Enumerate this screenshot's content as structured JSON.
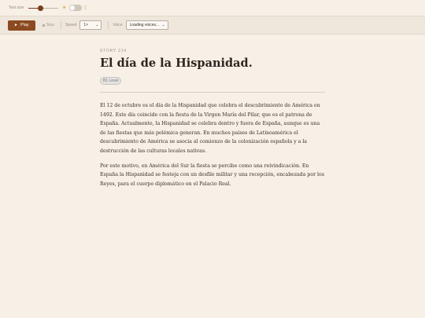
{
  "topbar": {
    "text_size_label": "Text size",
    "text_size_fraction": 0.4,
    "sun_icon": "☀",
    "moon_icon": "☾",
    "dark_mode": false
  },
  "toolbar": {
    "play_label": "Play",
    "play_icon": "►",
    "stop_label": "Stop",
    "speed_label": "Speed",
    "speed_value": "1×",
    "voice_label": "Voice",
    "voice_value": "Loading voices...",
    "chevron": "⌄"
  },
  "story": {
    "number": "STORY 214",
    "title": "El día de la Hispanidad.",
    "level": "B1 Level",
    "paragraphs": [
      "El 12 de octubre es el día de la Hispanidad que celebra el descubrimiento de América en 1492. Este día coincide con la fiesta de la Virgen María del Pilar, que es el patrona de España. Actualmente, la Hispanidad se celebra dentro y fuera de España, aunque es una de las fiestas que más polémica generan. En muchos países de Latinoamérica el descubrimiento de América se asocia al comienzo de la colonización española y a la destrucción de las culturas locales nativas.",
      "Por este motivo, en América del Sur la fiesta se percibe como una reivindicación. En España la Hispanidad se festeja con un desfile militar y una recepción, encabezada por los Reyes, para el cuerpo diplomático en el Palacio Real."
    ]
  },
  "colors": {
    "background": "#f6f0e7",
    "accent": "#8b4a1f",
    "text": "#3a3029"
  }
}
